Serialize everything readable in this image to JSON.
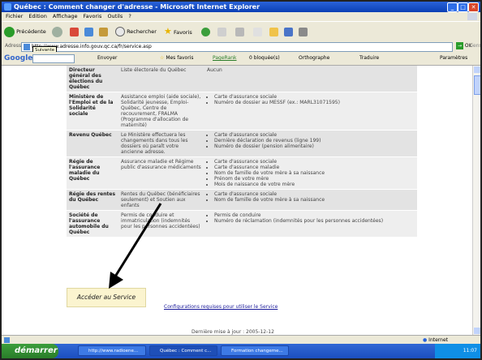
{
  "window": {
    "title": "Québec : Comment changer d'adresse - Microsoft Internet Explorer",
    "controls": [
      "_",
      "□",
      "✕"
    ]
  },
  "menu": [
    "Fichier",
    "Edition",
    "Affichage",
    "Favoris",
    "Outils",
    "?"
  ],
  "toolbar": {
    "back_label": "Précédente",
    "search_label": "Rechercher",
    "favorites_label": "Favoris"
  },
  "address": {
    "label": "Adresse",
    "url": "http://www.adresse.info.gouv.qc.ca/fr/service.asp",
    "tooltip": "Suivante",
    "go_label": "OK",
    "links_label": "Liens"
  },
  "google_bar": {
    "logo": "Google",
    "search_button": "Envoyer",
    "favorites": "Mes favoris",
    "pagerank": "PageRank",
    "blocked": "0 bloquée(s)",
    "spelling": "Orthographe",
    "translate": "Traduire",
    "params": "Paramètres"
  },
  "table": {
    "rows": [
      {
        "org": "Directeur général des élections du Québec",
        "programs": "Liste électorale du Québec",
        "documents": [
          "Aucun"
        ],
        "plain": true
      },
      {
        "org": "Ministère de l'Emploi et de la Solidarité sociale",
        "programs": "Assistance emploi (aide sociale), Solidarité jeunesse, Emploi-Québec, Centre de recouvrement, FRALMA (Programme d'allocation de maternité)",
        "documents": [
          "Carte d'assurance sociale",
          "Numéro de dossier au MESSF (ex.: MARL31071595)"
        ]
      },
      {
        "org": "Revenu Québec",
        "programs": "Le Ministère effectuera les changements dans tous les dossiers où paraît votre ancienne adresse.",
        "documents": [
          "Carte d'assurance sociale",
          "Dernière déclaration de revenus (ligne 199)",
          "Numéro de dossier (pension alimentaire)"
        ]
      },
      {
        "org": "Régie de l'assurance maladie du Québec",
        "programs": "Assurance maladie et Régime public d'assurance médicaments",
        "documents": [
          "Carte d'assurance sociale",
          "Carte d'assurance maladie",
          "Nom de famille de votre mère à sa naissance",
          "Prénom de votre mère",
          "Mois de naissance de votre mère"
        ]
      },
      {
        "org": "Régie des rentes du Québec",
        "programs": "Rentes du Québec (bénéficiaires seulement) et Soutien aux enfants",
        "documents": [
          "Carte d'assurance sociale",
          "Nom de famille de votre mère à sa naissance"
        ]
      },
      {
        "org": "Société de l'assurance automobile du Québec",
        "programs": "Permis de conduire et immatriculation (indemnités pour les personnes accidentées)",
        "documents": [
          "Permis de conduire",
          "Numéro de réclamation (indemnités pour les personnes accidentées)"
        ]
      }
    ]
  },
  "acceder_label": "Accéder au Service",
  "config_link": "Configurations requises pour utiliser le Service",
  "last_update": "Dernière mise à jour : 2005-12-12",
  "status": {
    "zone": "Internet"
  },
  "taskbar": {
    "start_label": "démarrer",
    "tasks": [
      {
        "label": "http://www.radioene..."
      },
      {
        "label": "Québec : Comment c..."
      },
      {
        "label": "Formation changeme..."
      }
    ],
    "clock": "11:07"
  },
  "colors": {
    "title_blue": "#0a3fb4",
    "start_green": "#2a7d2a",
    "acceder_bg": "#fbf4cf",
    "arrow": "#000000"
  }
}
